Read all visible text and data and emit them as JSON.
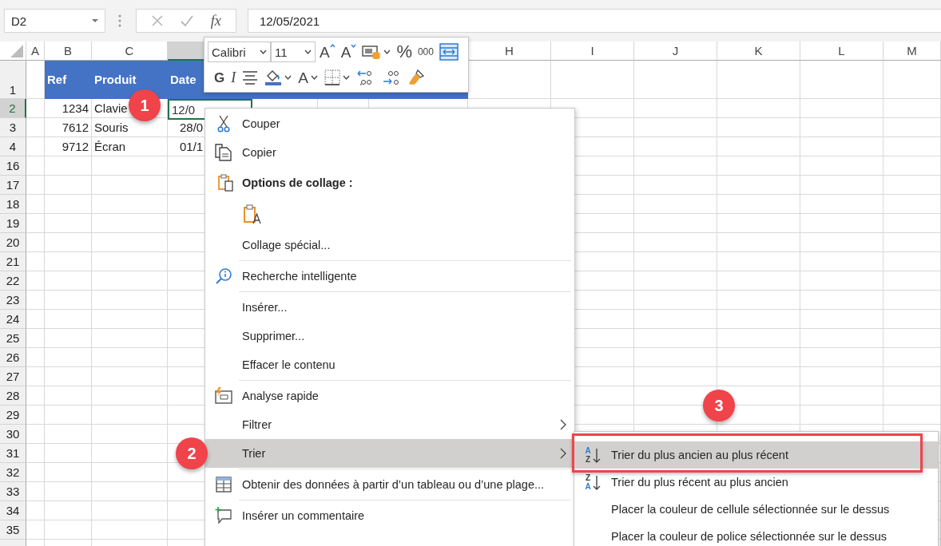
{
  "formula_bar": {
    "name_box": "D2",
    "function_button": "fx",
    "value": "12/05/2021"
  },
  "columns": [
    {
      "label": "A",
      "selected": false
    },
    {
      "label": "B",
      "selected": false
    },
    {
      "label": "C",
      "selected": false
    },
    {
      "selected": true
    },
    {},
    {},
    {},
    {
      "label": "H",
      "selected": false
    },
    {
      "label": "I",
      "selected": false
    },
    {
      "label": "J",
      "selected": false
    },
    {
      "label": "K",
      "selected": false
    },
    {
      "label": "L",
      "selected": false
    },
    {
      "label": "M",
      "selected": false
    }
  ],
  "rows": [
    {
      "number": "1",
      "selected": false,
      "kind": "header",
      "cells": [
        {
          "text": "Ref",
          "kind": "text",
          "selected": false
        },
        {
          "text": "Produit",
          "kind": "text",
          "selected": false
        },
        {
          "text": "Date",
          "kind": "text",
          "selected": false
        }
      ]
    },
    {
      "number": "2",
      "selected": true,
      "kind": "data",
      "cells": [
        {
          "text": "1234",
          "kind": "number",
          "selected": false
        },
        {
          "text": "Clavie",
          "kind": "text",
          "selected": false
        },
        {
          "text": "12/0",
          "kind": "date",
          "selected": true
        }
      ]
    },
    {
      "number": "3",
      "selected": false,
      "kind": "data",
      "cells": [
        {
          "text": "7612",
          "kind": "number",
          "selected": false
        },
        {
          "text": "Souris",
          "kind": "text",
          "selected": false
        },
        {
          "text": "28/0",
          "kind": "date",
          "selected": false
        }
      ]
    },
    {
      "number": "4",
      "selected": false,
      "kind": "data",
      "cells": [
        {
          "text": "9712",
          "kind": "number",
          "selected": false
        },
        {
          "text": "Écran",
          "kind": "text",
          "selected": false
        },
        {
          "text": "01/1",
          "kind": "date",
          "selected": false
        }
      ]
    },
    {
      "number": "16",
      "selected": false,
      "kind": "data"
    },
    {
      "number": "17",
      "selected": false,
      "kind": "data"
    },
    {
      "number": "18",
      "selected": false,
      "kind": "data"
    },
    {
      "number": "19",
      "selected": false,
      "kind": "data"
    },
    {
      "number": "20",
      "selected": false,
      "kind": "data"
    },
    {
      "number": "21",
      "selected": false,
      "kind": "data"
    },
    {
      "number": "22",
      "selected": false,
      "kind": "data"
    },
    {
      "number": "23",
      "selected": false,
      "kind": "data"
    },
    {
      "number": "24",
      "selected": false,
      "kind": "data"
    },
    {
      "number": "25",
      "selected": false,
      "kind": "data"
    },
    {
      "number": "26",
      "selected": false,
      "kind": "data"
    },
    {
      "number": "27",
      "selected": false,
      "kind": "data"
    },
    {
      "number": "28",
      "selected": false,
      "kind": "data"
    },
    {
      "number": "29",
      "selected": false,
      "kind": "data"
    },
    {
      "number": "30",
      "selected": false,
      "kind": "data"
    },
    {
      "number": "31",
      "selected": false,
      "kind": "data"
    },
    {
      "number": "32",
      "selected": false,
      "kind": "data"
    },
    {
      "number": "33",
      "selected": false,
      "kind": "data"
    },
    {
      "number": "34",
      "selected": false,
      "kind": "data"
    },
    {
      "number": "35",
      "selected": false,
      "kind": "data"
    }
  ],
  "mini_toolbar": {
    "font": "Calibri",
    "size": "11",
    "row_1": [
      {
        "kind": "grow-font",
        "label": "A",
        "has_caret": false
      },
      {
        "kind": "shrink-font",
        "label": "A",
        "has_caret": false
      },
      {
        "kind": "number-format",
        "has_caret": true
      },
      {
        "kind": "percent-style",
        "label": "%",
        "has_caret": false
      },
      {
        "kind": "thousands-style",
        "label": "000",
        "has_caret": false
      },
      {
        "kind": "wrap-text",
        "has_caret": false
      }
    ],
    "row_2": [
      {
        "kind": "bold",
        "label": "G",
        "has_caret": false
      },
      {
        "kind": "italic",
        "label": "I",
        "has_caret": false
      },
      {
        "kind": "align-center",
        "has_caret": false
      },
      {
        "kind": "fill-color",
        "has_caret": true
      },
      {
        "kind": "font-color",
        "label": "A",
        "has_caret": true
      },
      {
        "kind": "borders",
        "has_caret": true
      },
      {
        "kind": "increase-decimal",
        "has_caret": false
      },
      {
        "kind": "decrease-decimal",
        "has_caret": false
      },
      {
        "kind": "format-painter",
        "has_caret": false
      }
    ]
  },
  "context_menu": [
    {
      "kind": "command",
      "label": "Couper",
      "selected": false,
      "has_submenu": false,
      "separator_before": false
    },
    {
      "kind": "command",
      "label": "Copier",
      "selected": false,
      "has_submenu": false,
      "separator_before": false
    },
    {
      "kind": "heading",
      "label": "Options de collage :",
      "selected": false,
      "has_submenu": false,
      "separator_before": false
    },
    {
      "kind": "paste-options",
      "selected": false,
      "has_submenu": false,
      "separator_before": false
    },
    {
      "kind": "command",
      "label": "Collage spécial...",
      "selected": false,
      "has_submenu": false,
      "separator_before": false
    },
    {
      "kind": "command",
      "label": "Recherche intelligente",
      "selected": false,
      "has_submenu": false,
      "separator_before": true
    },
    {
      "kind": "command",
      "label": "Insérer...",
      "selected": false,
      "has_submenu": false,
      "separator_before": true
    },
    {
      "kind": "command",
      "label": "Supprimer...",
      "selected": false,
      "has_submenu": false,
      "separator_before": false
    },
    {
      "kind": "command",
      "label": "Effacer le contenu",
      "selected": false,
      "has_submenu": false,
      "separator_before": false
    },
    {
      "kind": "command",
      "label": "Analyse rapide",
      "selected": false,
      "has_submenu": false,
      "separator_before": true
    },
    {
      "kind": "command",
      "label": "Filtrer",
      "selected": false,
      "has_submenu": true,
      "separator_before": false
    },
    {
      "kind": "command",
      "label": "Trier",
      "selected": true,
      "has_submenu": true,
      "separator_before": false
    },
    {
      "kind": "command",
      "label": "Obtenir des données à partir d’un tableau ou d’une plage...",
      "selected": false,
      "has_submenu": false,
      "separator_before": true
    },
    {
      "kind": "command",
      "label": "Insérer un commentaire",
      "selected": false,
      "has_submenu": false,
      "separator_before": true
    }
  ],
  "submenu": [
    {
      "label": "Trier du plus ancien au plus récent",
      "icon_letters": [
        "A",
        "Z"
      ],
      "selected": true
    },
    {
      "label": "Trier du plus récent au plus ancien",
      "icon_letters": [
        "Z",
        "A"
      ],
      "selected": false
    },
    {
      "label": "Placer la couleur de cellule sélectionnée sur le dessus",
      "selected": false
    },
    {
      "label": "Placer la couleur de police sélectionnée sur le dessus",
      "selected": false
    }
  ],
  "step_badges": [
    {
      "label": "1"
    },
    {
      "label": "2"
    },
    {
      "label": "3"
    }
  ]
}
